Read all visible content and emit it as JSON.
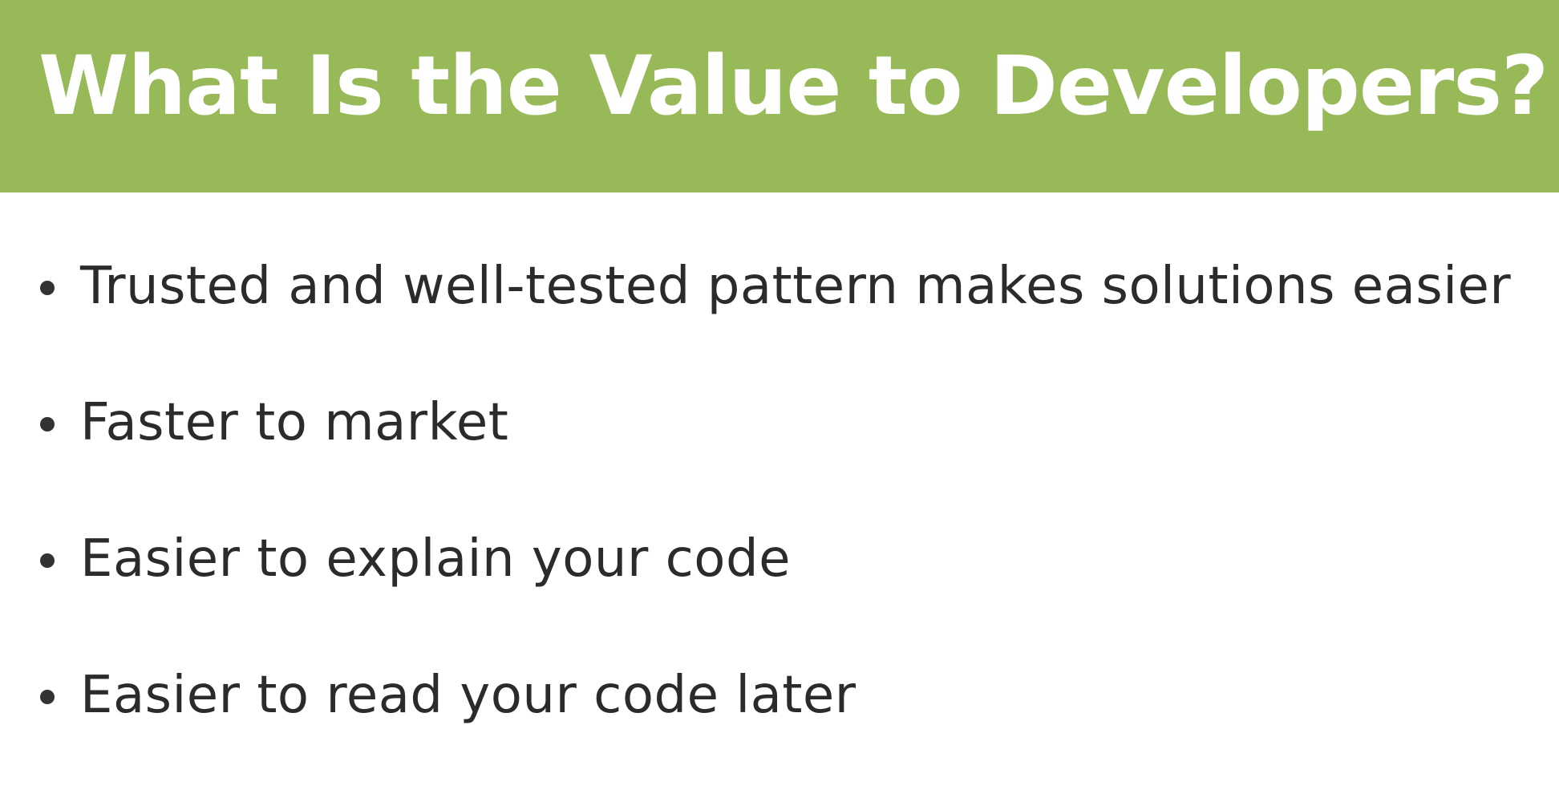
{
  "slide": {
    "title": "What Is the Value to Developers?",
    "bullets": [
      "Trusted and well-tested pattern makes solutions easier",
      "Faster to market",
      "Easier to explain your code",
      "Easier to read your code later"
    ]
  },
  "colors": {
    "title_bar": "#97b957",
    "title_text": "#ffffff",
    "body_text": "#2b2b2b",
    "background": "#ffffff"
  }
}
